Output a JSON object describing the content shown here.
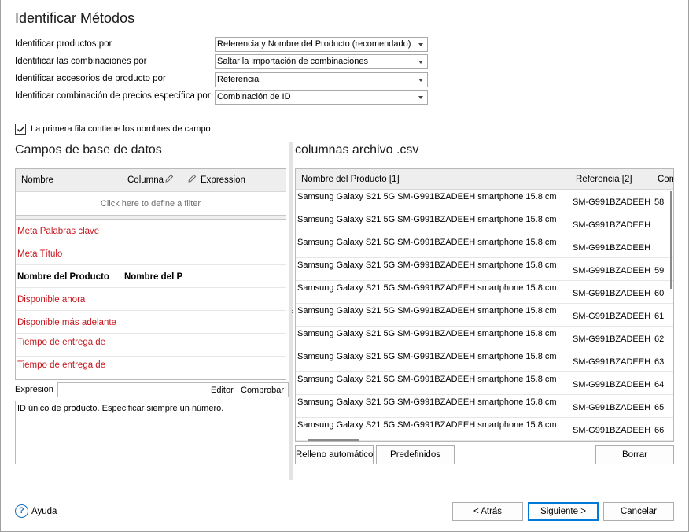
{
  "window": {
    "title": "Identificar Métodos"
  },
  "identify": {
    "rows": [
      {
        "label": "Identificar productos por",
        "value": "Referencia y Nombre del Producto (recomendado)"
      },
      {
        "label": "Identificar las combinaciones por",
        "value": "Saltar la importación de combinaciones"
      },
      {
        "label": "Identificar accesorios de producto por",
        "value": "Referencia"
      },
      {
        "label": "Identificar combinación de precios específica por",
        "value": "Combinación de ID"
      }
    ],
    "first_row_checkbox": {
      "label": "La primera fila contiene los nombres de campo",
      "checked": true
    }
  },
  "db_fields": {
    "title": "Campos de base de datos",
    "columns": {
      "name": "Nombre",
      "column": "Columna",
      "expression": "Expression"
    },
    "filter_hint": "Click here to define a filter",
    "rows": [
      {
        "name": "Meta Palabras clave",
        "column": "",
        "style": "red"
      },
      {
        "name": "Meta Título",
        "column": "",
        "style": "red"
      },
      {
        "name": "Nombre del Producto",
        "column": "Nombre del P",
        "style": "bold"
      },
      {
        "name": "Disponible ahora",
        "column": "",
        "style": "red"
      },
      {
        "name": "Disponible más adelante",
        "column": "",
        "style": "red"
      },
      {
        "name": "Tiempo de entrega de",
        "column": "",
        "style": "red"
      },
      {
        "name": "Tiempo de entrega de",
        "column": "",
        "style": "red"
      }
    ]
  },
  "expression": {
    "label": "Expresión",
    "editor_label": "Editor",
    "check_label": "Comprobar",
    "text": "ID único de producto. Especificar siempre un número."
  },
  "csv": {
    "title": "columnas archivo .csv",
    "columns": [
      "Nombre del Producto [1]",
      "Referencia [2]",
      "Com"
    ],
    "rows": [
      {
        "name": "Samsung Galaxy S21 5G SM-G991BZADEEH smartphone 15.8 cm",
        "ref": "SM-G991BZADEEH",
        "c": "58"
      },
      {
        "name": "Samsung Galaxy S21 5G SM-G991BZADEEH smartphone 15.8 cm",
        "ref": "SM-G991BZADEEH",
        "c": ""
      },
      {
        "name": "Samsung Galaxy S21 5G SM-G991BZADEEH smartphone 15.8 cm",
        "ref": "SM-G991BZADEEH",
        "c": ""
      },
      {
        "name": "Samsung Galaxy S21 5G SM-G991BZADEEH smartphone 15.8 cm",
        "ref": "SM-G991BZADEEH",
        "c": "59"
      },
      {
        "name": "Samsung Galaxy S21 5G SM-G991BZADEEH smartphone 15.8 cm",
        "ref": "SM-G991BZADEEH",
        "c": "60"
      },
      {
        "name": "Samsung Galaxy S21 5G SM-G991BZADEEH smartphone 15.8 cm",
        "ref": "SM-G991BZADEEH",
        "c": "61"
      },
      {
        "name": "Samsung Galaxy S21 5G SM-G991BZADEEH smartphone 15.8 cm",
        "ref": "SM-G991BZADEEH",
        "c": "62"
      },
      {
        "name": "Samsung Galaxy S21 5G SM-G991BZADEEH smartphone 15.8 cm",
        "ref": "SM-G991BZADEEH",
        "c": "63"
      },
      {
        "name": "Samsung Galaxy S21 5G SM-G991BZADEEH smartphone 15.8 cm",
        "ref": "SM-G991BZADEEH",
        "c": "64"
      },
      {
        "name": "Samsung Galaxy S21 5G SM-G991BZADEEH smartphone 15.8 cm",
        "ref": "SM-G991BZADEEH",
        "c": "65"
      },
      {
        "name": "Samsung Galaxy S21 5G SM-G991BZADEEH smartphone 15.8 cm",
        "ref": "SM-G991BZADEEH",
        "c": "66"
      }
    ]
  },
  "actions": {
    "autofill": "Relleno automático",
    "predefined": "Predefinidos",
    "clear": "Borrar"
  },
  "footer": {
    "help": "Ayuda",
    "back": "< Atrás",
    "next": "Siguiente >",
    "cancel": "Cancelar"
  },
  "colors": {
    "required_field": "#c8161d",
    "help_icon": "#1a6fc0",
    "default_button_border": "#0078d7"
  }
}
